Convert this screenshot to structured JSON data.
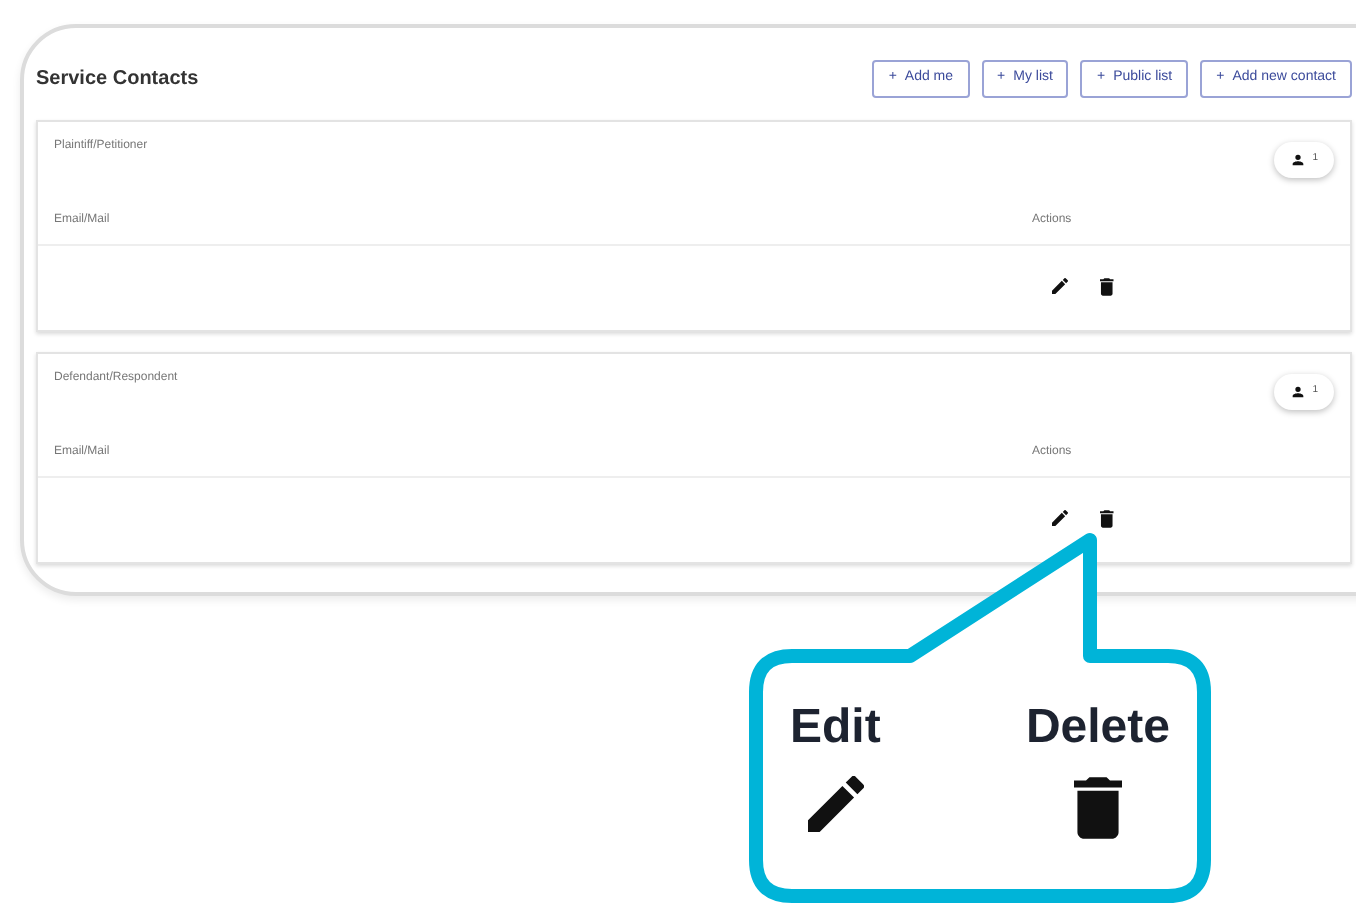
{
  "title": "Service Contacts",
  "header_buttons": [
    {
      "icon": "+",
      "label": "Add me"
    },
    {
      "icon": "+",
      "label": "My list"
    },
    {
      "icon": "+",
      "label": "Public list"
    },
    {
      "icon": "+",
      "label": "Add new contact"
    }
  ],
  "sections": [
    {
      "title": "Plaintiff/Petitioner",
      "count": "1",
      "columns": [
        "Email/Mail",
        "Actions"
      ]
    },
    {
      "title": "Defendant/Respondent",
      "count": "1",
      "columns": [
        "Email/Mail",
        "Actions"
      ]
    }
  ],
  "callout": {
    "labels": [
      {
        "kind": "edit",
        "label": "Edit"
      },
      {
        "kind": "delete",
        "label": "Delete"
      }
    ]
  }
}
